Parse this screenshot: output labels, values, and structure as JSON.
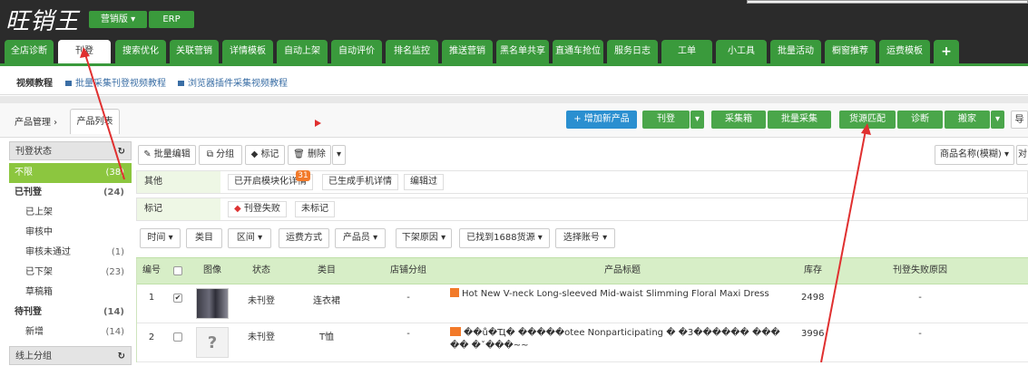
{
  "header": {
    "logo": "旺销王",
    "version_button": "营销版 ▾",
    "erp_button": "ERP"
  },
  "tabs": [
    "全店诊断",
    "刊登",
    "搜索优化",
    "关联营销",
    "详情模板",
    "自动上架",
    "自动评价",
    "排名监控",
    "推送营销",
    "黑名单共享",
    "直通车抢位",
    "服务日志",
    "工单",
    "小工具",
    "批量活动",
    "橱窗推荐",
    "运费模板",
    "+"
  ],
  "subnav": {
    "title": "视频教程",
    "link1": "批量采集刊登视频教程",
    "link2": "浏览器插件采集视频教程"
  },
  "breadcrumb": {
    "item1": "产品管理 ›",
    "item2": "产品列表"
  },
  "actions": {
    "add_product": "+ 增加新产品",
    "publish": "刊登",
    "collect": "采集箱",
    "batch_collect": "批量采集",
    "source_match": "货源匹配",
    "diagnose": "诊断",
    "move": "搬家",
    "export": "导"
  },
  "sidebar": {
    "status_header": "刊登状态",
    "refresh_icon": "refresh-icon",
    "items": [
      {
        "label": "不限",
        "count": "(38)"
      },
      {
        "label": "已刊登",
        "count": "(24)"
      },
      {
        "label": "已上架",
        "count": ""
      },
      {
        "label": "审核中",
        "count": ""
      },
      {
        "label": "审核未通过",
        "count": "(1)"
      },
      {
        "label": "已下架",
        "count": "(23)"
      },
      {
        "label": "草稿箱",
        "count": ""
      },
      {
        "label": "待刊登",
        "count": "(14)"
      },
      {
        "label": "新增",
        "count": "(14)"
      }
    ],
    "group_header": "线上分组"
  },
  "toolbar": {
    "batch_edit": "批量编辑",
    "group": "分组",
    "mark": "标记",
    "delete": "删除",
    "sort_select": "商品名称(模糊) ▾",
    "right_cut": "对"
  },
  "filters": {
    "other_label": "其他",
    "chip1": "已开启模块化详情",
    "chip2": "已生成手机详情",
    "chip3": "编辑过",
    "badge": "31",
    "mark_label": "标记",
    "mark_chip1": "刊登失败",
    "mark_chip2": "未标记"
  },
  "filter_buttons": [
    "时间 ▾",
    "类目",
    "区间 ▾",
    "运费方式",
    "产品员 ▾",
    "下架原因 ▾",
    "已找到1688货源 ▾",
    "选择账号 ▾"
  ],
  "table": {
    "headers": [
      "编号",
      "",
      "图像",
      "状态",
      "类目",
      "店铺分组",
      "产品标题",
      "库存",
      "刊登失败原因"
    ],
    "rows": [
      {
        "no": "1",
        "checked": true,
        "status": "未刊登",
        "category": "连衣裙",
        "group": "-",
        "title": "Hot New V-neck Long-sleeved Mid-waist Slimming Floral Maxi Dress",
        "stock": "2498",
        "reason": "-"
      },
      {
        "no": "2",
        "checked": false,
        "status": "未刊登",
        "category": "T恤",
        "group": "-",
        "title": "��ů�Ҵ� �����otee Nonparticipating �        �3������ ��� �� �ˇ���~~",
        "stock": "3996",
        "reason": "-",
        "image_placeholder": "?"
      }
    ]
  }
}
